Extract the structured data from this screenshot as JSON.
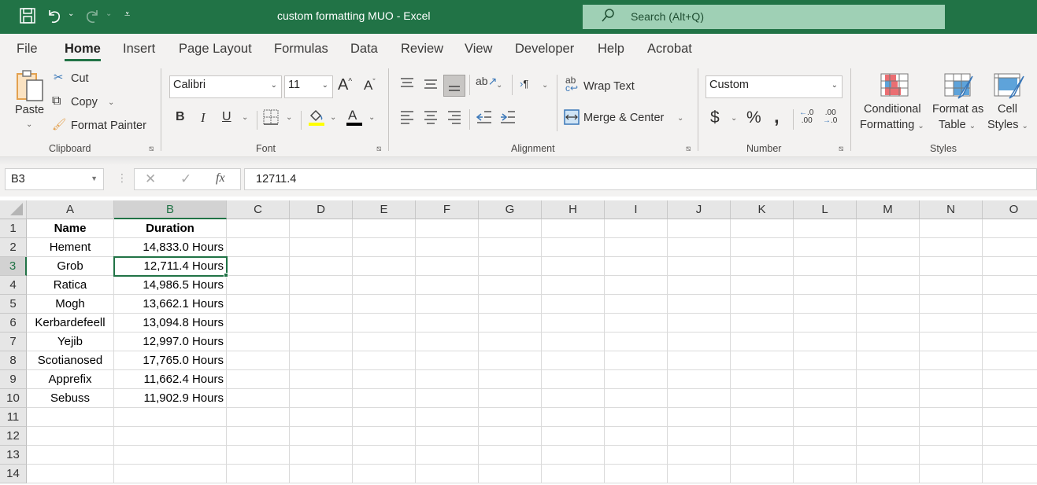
{
  "titlebar": {
    "title": "custom formatting MUO  -  Excel",
    "search_placeholder": "Search (Alt+Q)",
    "save_icon": "save-icon",
    "undo_icon": "undo-icon",
    "redo_icon": "redo-icon",
    "customize_icon": "customize-quick-access-icon"
  },
  "menu": {
    "tabs": [
      "File",
      "Home",
      "Insert",
      "Page Layout",
      "Formulas",
      "Data",
      "Review",
      "View",
      "Developer",
      "Help",
      "Acrobat"
    ],
    "active": "Home"
  },
  "ribbon": {
    "clipboard": {
      "label": "Clipboard",
      "paste": "Paste",
      "cut": "Cut",
      "copy": "Copy",
      "format_painter": "Format Painter"
    },
    "font": {
      "label": "Font",
      "font_name": "Calibri",
      "font_size": "11",
      "bold": "B",
      "italic": "I",
      "underline": "U",
      "font_color_letter": "A",
      "grow_font": "A",
      "shrink_font": "A",
      "fill_color": "#ffff00",
      "font_color": "#000000"
    },
    "alignment": {
      "label": "Alignment",
      "wrap_text": "Wrap Text",
      "merge_center": "Merge & Center"
    },
    "number": {
      "label": "Number",
      "format": "Custom",
      "currency": "$",
      "percent": "%",
      "comma": "❟",
      "increase_decimal": "←.0 .00",
      "decrease_decimal": ".00 →.0"
    },
    "styles": {
      "label": "Styles",
      "conditional_formatting_1": "Conditional",
      "conditional_formatting_2": "Formatting",
      "format_table_1": "Format as",
      "format_table_2": "Table",
      "cell_styles_1": "Cell",
      "cell_styles_2": "Styles"
    }
  },
  "formula_bar": {
    "name_box": "B3",
    "formula": "12711.4",
    "fx": "fx",
    "cancel": "✕",
    "enter": "✓"
  },
  "sheet": {
    "columns": [
      "A",
      "B",
      "C",
      "D",
      "E",
      "F",
      "G",
      "H",
      "I",
      "J",
      "K",
      "L",
      "M",
      "N",
      "O"
    ],
    "rows": [
      "1",
      "2",
      "3",
      "4",
      "5",
      "6",
      "7",
      "8",
      "9",
      "10",
      "11",
      "12",
      "13",
      "14"
    ],
    "selected_cell": "B3",
    "header": {
      "name": "Name",
      "duration": "Duration"
    },
    "data": [
      {
        "name": "Hement",
        "duration": "14,833.0 Hours"
      },
      {
        "name": "Grob",
        "duration": "12,711.4 Hours"
      },
      {
        "name": "Ratica",
        "duration": "14,986.5 Hours"
      },
      {
        "name": "Mogh",
        "duration": "13,662.1 Hours"
      },
      {
        "name": "Kerbardefeell",
        "duration": "13,094.8 Hours"
      },
      {
        "name": "Yejib",
        "duration": "12,997.0 Hours"
      },
      {
        "name": "Scotianosed",
        "duration": "17,765.0 Hours"
      },
      {
        "name": "Apprefix",
        "duration": "11,662.4 Hours"
      },
      {
        "name": "Sebuss",
        "duration": "11,902.9 Hours"
      }
    ]
  },
  "colors": {
    "brand": "#217346",
    "search_bg": "#9fd0b5"
  }
}
